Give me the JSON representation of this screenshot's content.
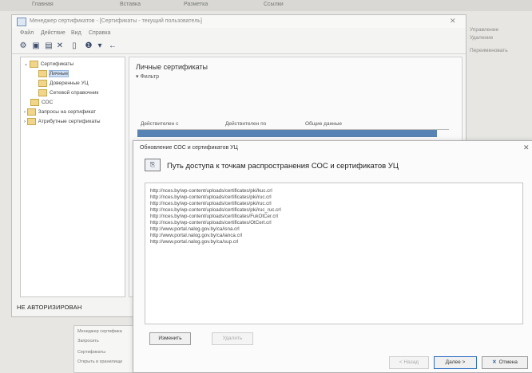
{
  "background": {
    "strip_items": [
      "Главная",
      "Вставка",
      "Разметка",
      "Ссылки"
    ]
  },
  "window": {
    "title": "Менеджер сертификатов - [Сертификаты - текущий пользователь]",
    "menu": [
      "Файл",
      "Действие",
      "Вид",
      "Справка"
    ]
  },
  "tree": {
    "items": [
      {
        "label": "Сертификаты",
        "level": 0
      },
      {
        "label": "Личные",
        "level": 1,
        "selected": true
      },
      {
        "label": "Доверенные УЦ",
        "level": 1
      },
      {
        "label": "Сетевой справочник",
        "level": 1
      },
      {
        "label": "СОС",
        "level": 0
      },
      {
        "label": "Запросы на сертификат",
        "level": 0
      },
      {
        "label": "Атрибутные сертификаты",
        "level": 0
      }
    ],
    "status": "НЕ АВТОРИЗИРОВАН"
  },
  "right_pane": {
    "title": "Личные сертификаты",
    "filter": "▾ Фильтр",
    "columns": [
      "Действителен с",
      "Действителен по",
      "Общие данные"
    ]
  },
  "side_fragments": [
    "Управление",
    "Удаление",
    "Переименовать"
  ],
  "small_window": {
    "lines": [
      "Менеджер сертифика",
      "Запросить",
      "Сертификаты",
      "Открыть в хранилище"
    ]
  },
  "dialog": {
    "title": "Обновление СОС и сертификатов УЦ",
    "heading": "Путь доступа к точкам распространения СОС и сертификатов УЦ",
    "urls": [
      "http://nces.by/wp-content/uploads/certificates/pki/kuc.crl",
      "http://nces.by/wp-content/uploads/certificates/pki/ruc.crl",
      "http://nces.by/wp-content/uploads/certificates/pki/ruc.crl",
      "http://nces.by/wp-content/uploads/certificates/pki/ruc_ruc.crl",
      "http://nces.by/wp-content/uploads/certificates/FukOtCer.crl",
      "http://nces.by/wp-content/uploads/certificates/OtCert.crl",
      "http://www.portal.nalog.gov.by/ca/isna.crl",
      "http://www.portal.nalog.gov.by/ca/ianca.crl",
      "http://www.portal.nalog.gov.by/ca/sup.crl"
    ],
    "buttons": {
      "change": "Изменить",
      "delete": "Удалить",
      "back": "< Назад",
      "next": "Далее >",
      "cancel": "Отмена"
    }
  }
}
